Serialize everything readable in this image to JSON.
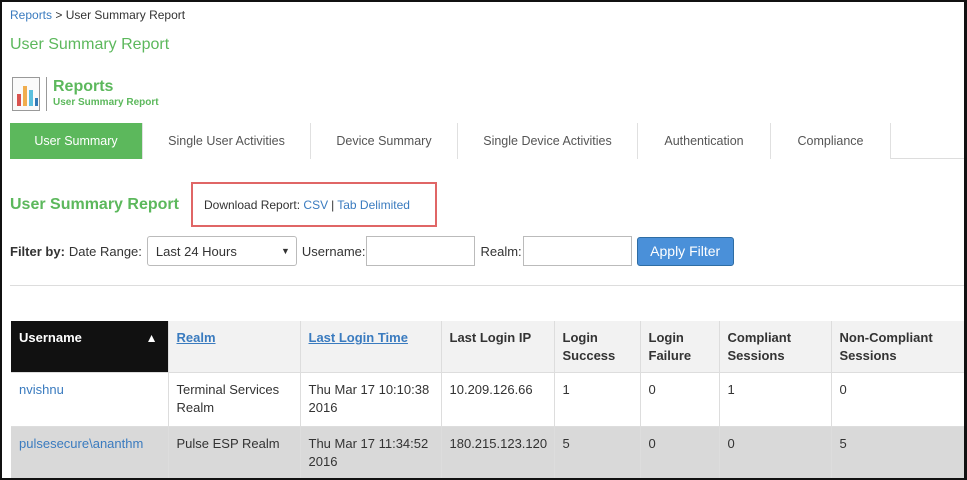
{
  "breadcrumb": {
    "link": "Reports",
    "separator": ">",
    "current": "User Summary Report"
  },
  "page_title": "User Summary Report",
  "header": {
    "title": "Reports",
    "subtitle": "User Summary Report",
    "icon": "report-chart-icon"
  },
  "tabs": [
    {
      "label": "User Summary",
      "active": true
    },
    {
      "label": "Single User Activities",
      "active": false
    },
    {
      "label": "Device Summary",
      "active": false
    },
    {
      "label": "Single Device Activities",
      "active": false
    },
    {
      "label": "Authentication",
      "active": false
    },
    {
      "label": "Compliance",
      "active": false
    }
  ],
  "section_title": "User Summary Report",
  "download": {
    "label": "Download Report:",
    "csv": "CSV",
    "separator": "|",
    "tab_delimited": "Tab Delimited"
  },
  "filter": {
    "label": "Filter by:",
    "date_range_label": "Date Range:",
    "date_range_value": "Last 24 Hours",
    "username_label": "Username:",
    "username_value": "",
    "realm_label": "Realm:",
    "realm_value": "",
    "apply_label": "Apply Filter"
  },
  "table": {
    "columns": [
      {
        "label": "Username",
        "sorted": true,
        "link": false
      },
      {
        "label": "Realm",
        "sorted": false,
        "link": true
      },
      {
        "label": "Last Login Time",
        "sorted": false,
        "link": true
      },
      {
        "label": "Last Login IP",
        "sorted": false,
        "link": false
      },
      {
        "label": "Login Success",
        "sorted": false,
        "link": false
      },
      {
        "label": "Login Failure",
        "sorted": false,
        "link": false
      },
      {
        "label": "Compliant Sessions",
        "sorted": false,
        "link": false
      },
      {
        "label": "Non-Compliant Sessions",
        "sorted": false,
        "link": false
      }
    ],
    "rows": [
      {
        "username": "nvishnu",
        "realm": "Terminal Services Realm",
        "last_login_time": "Thu Mar 17 10:10:38 2016",
        "last_login_ip": "10.209.126.66",
        "login_success": "1",
        "login_failure": "0",
        "compliant": "1",
        "non_compliant": "0"
      },
      {
        "username": "pulsesecure\\ananthm",
        "realm": "Pulse ESP Realm",
        "last_login_time": "Thu Mar 17 11:34:52 2016",
        "last_login_ip": "180.215.123.120",
        "login_success": "5",
        "login_failure": "0",
        "compliant": "0",
        "non_compliant": "5"
      }
    ]
  },
  "colors": {
    "accent_green": "#5cb85c",
    "link_blue": "#3a7bbf",
    "button_blue": "#4a90d9",
    "highlight_red": "#e06666"
  }
}
